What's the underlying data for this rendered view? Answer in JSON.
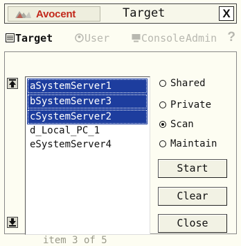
{
  "titlebar": {
    "brand": "Avocent",
    "title": "Target",
    "close": "X"
  },
  "tabs": [
    {
      "label": "Target",
      "active": true,
      "icon": "list-icon"
    },
    {
      "label": "User",
      "active": false,
      "icon": "user-icon"
    },
    {
      "label": "Console",
      "active": false,
      "icon": "console-icon"
    },
    {
      "label": "Admin",
      "active": false
    }
  ],
  "help": "?",
  "targets": [
    {
      "label": "aSystemServer1",
      "selected": true
    },
    {
      "label": "bSystemServer3",
      "selected": true
    },
    {
      "label": "cSystemServer2",
      "selected": true
    },
    {
      "label": "d_Local_PC_1",
      "selected": false
    },
    {
      "label": "eSystemServer4",
      "selected": false
    }
  ],
  "modes": [
    {
      "label": "Shared",
      "checked": false
    },
    {
      "label": "Private",
      "checked": false
    },
    {
      "label": "Scan",
      "checked": true
    },
    {
      "label": "Maintain",
      "checked": false
    }
  ],
  "buttons": {
    "start": "Start",
    "clear": "Clear",
    "close": "Close"
  },
  "status": "item 3 of 5",
  "colors": {
    "brand": "#c2281a",
    "selection": "#1d3d9e",
    "background": "#fdfdf2"
  }
}
